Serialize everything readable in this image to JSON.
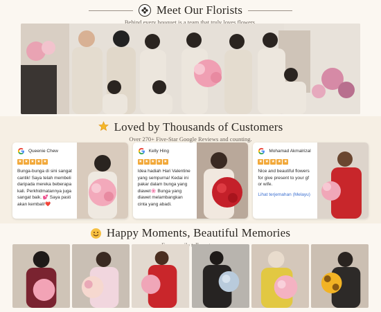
{
  "florists": {
    "title": "Meet Our Florists",
    "subtitle": "Behind every bouquet is a team that truly loves flowers.",
    "emblem_icon": "flower-emblem-icon"
  },
  "reviews_section": {
    "title": "Loved by Thousands of Customers",
    "subtitle": "Over 270+ Five-Star Google Reviews and counting.",
    "title_icon": "star-emoji-icon"
  },
  "reviews": [
    {
      "name": "Queenie Chew",
      "rating": 5,
      "text": "Bunga-bunga di sini sangat cantik! Saya telah membeli daripada mereka beberapa kali. Perkhidmatannya juga sangat baik. 💕 Saya pasti akan kembali!❤️",
      "link": ""
    },
    {
      "name": "Kelly Hing",
      "rating": 5,
      "text": "Idea hadiah Hari Valentine yang sempurna! Kedai ini pakar dalam bunga yang diawet🌸 Bunga yang diawet melambangkan cinta yang abadi.",
      "link": ""
    },
    {
      "name": "Mohamad Akmalrizal",
      "rating": 5,
      "text": "Nice and beautiful flowers for give present to your gf or wife.",
      "link": "Lihat terjemahan (Melayu)"
    }
  ],
  "moments_section": {
    "title": "Happy Moments, Beautiful Memories",
    "subtitle": "Every smile tells a story.",
    "title_icon": "smile-emoji-icon"
  },
  "colors": {
    "background": "#fbf7f1",
    "band": "#f6efe4",
    "star": "#f2a93b",
    "link": "#3b6fd0"
  }
}
